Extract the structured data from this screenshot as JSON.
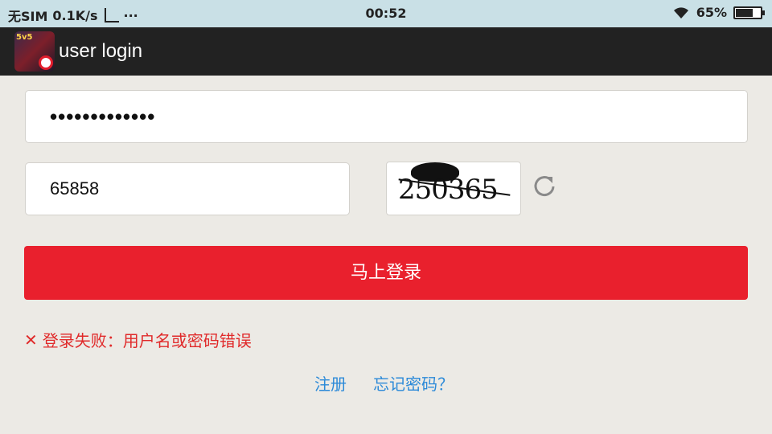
{
  "status_bar": {
    "carrier": "无SIM",
    "speed": "0.1K/s",
    "extra": "···",
    "time": "00:52",
    "battery": "65%",
    "battery_level": 0.65,
    "icons": [
      "screenshot-icon",
      "wifi-icon",
      "battery-icon"
    ]
  },
  "app_bar": {
    "title": "user login",
    "icon": "app-logo-icon",
    "background": "#222222"
  },
  "form": {
    "password_value": "•••••••••••••",
    "captcha_value": "65858",
    "captcha_image_text": "250365",
    "refresh_icon": "refresh-icon",
    "login_label": "马上登录",
    "login_color": "#e9202d"
  },
  "error": {
    "icon": "error-x-icon",
    "message": "登录失败：用户名或密码错误",
    "color": "#e02a2a"
  },
  "links": {
    "register": "注册",
    "forgot": "忘记密码？",
    "color": "#2c8ad8"
  }
}
